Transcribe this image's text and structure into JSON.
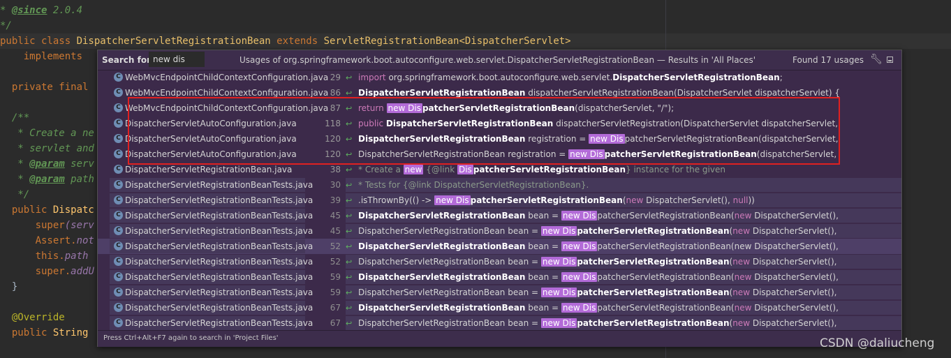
{
  "editor": {
    "lines": [
      {
        "a": "* ",
        "b": "@since",
        "c": " 2.0.4"
      },
      {
        "t": "*/"
      },
      {
        "kw": "public class ",
        "cls": "DispatcherServletRegistrationBean",
        "kw2": " extends ",
        "cls2": "ServletRegistrationBean<DispatcherServlet>"
      },
      {
        "kw": "    implements"
      },
      {
        "t": ""
      },
      {
        "kw": "  private final"
      },
      {
        "t": ""
      },
      {
        "t": "  /**"
      },
      {
        "t": "   * Create a ne"
      },
      {
        "t": "   * servlet and"
      },
      {
        "a": "   * ",
        "b": "@param",
        "c": " serv"
      },
      {
        "a": "   * ",
        "b": "@param",
        "c": " path"
      },
      {
        "t": "   */"
      },
      {
        "kw": "  public ",
        "d": "Dispatc"
      },
      {
        "kw": "      super",
        "e": "(serv"
      },
      {
        "kw": "      Assert.",
        "e": "not"
      },
      {
        "kw": "      this.",
        "e": "path"
      },
      {
        "kw": "      super.",
        "e": "addU"
      },
      {
        "t": "  }"
      },
      {
        "t": ""
      },
      {
        "ann": "  @Override"
      },
      {
        "kw": "  public ",
        "d": "String"
      }
    ]
  },
  "popup": {
    "search_label": "Search for:",
    "search_value": "new dis",
    "title": "Usages of org.springframework.boot.autoconfigure.web.servlet.DispatcherServletRegistrationBean — Results in 'All Places'",
    "found": "Found 17 usages",
    "settings_icon": "wrench-icon",
    "pin_icon": "pin-icon",
    "footer_hint": "Press Ctrl+Alt+F7 again to search in 'Project Files'",
    "rows": [
      {
        "file": "WebMvcEndpointChildContextConfiguration.java",
        "line": "29",
        "test": false,
        "sel": false,
        "parts": [
          {
            "k": "kw",
            "t": "import "
          },
          {
            "k": "n",
            "t": "org.springframework.boot.autoconfigure.web.servlet."
          },
          {
            "k": "b",
            "t": "DispatcherServletRegistrationBean"
          },
          {
            "k": "n",
            "t": ";"
          }
        ]
      },
      {
        "file": "WebMvcEndpointChildContextConfiguration.java",
        "line": "86",
        "test": false,
        "sel": false,
        "parts": [
          {
            "k": "b",
            "t": "DispatcherServletRegistrationBean"
          },
          {
            "k": "n",
            "t": " dispatcherServletRegistrationBean(DispatcherServlet dispatcherServlet) {"
          }
        ]
      },
      {
        "file": "WebMvcEndpointChildContextConfiguration.java",
        "line": "87",
        "test": false,
        "sel": false,
        "parts": [
          {
            "k": "kw",
            "t": "return "
          },
          {
            "k": "m",
            "t": "new Dis"
          },
          {
            "k": "b",
            "t": "patcherServletRegistrationBean"
          },
          {
            "k": "n",
            "t": "(dispatcherServlet, \"/\");"
          }
        ]
      },
      {
        "file": "DispatcherServletAutoConfiguration.java",
        "line": "118",
        "test": false,
        "sel": false,
        "parts": [
          {
            "k": "kw",
            "t": "public "
          },
          {
            "k": "b",
            "t": "DispatcherServletRegistrationBean"
          },
          {
            "k": "n",
            "t": " dispatcherServletRegistration(DispatcherServlet dispatcherServlet,"
          }
        ]
      },
      {
        "file": "DispatcherServletAutoConfiguration.java",
        "line": "120",
        "test": false,
        "sel": false,
        "parts": [
          {
            "k": "b",
            "t": "DispatcherServletRegistrationBean"
          },
          {
            "k": "n",
            "t": " registration = "
          },
          {
            "k": "m",
            "t": "new Dis"
          },
          {
            "k": "n",
            "t": "patcherServletRegistrationBean(dispatcherServlet,"
          }
        ]
      },
      {
        "file": "DispatcherServletAutoConfiguration.java",
        "line": "120",
        "test": false,
        "sel": false,
        "parts": [
          {
            "k": "n",
            "t": "DispatcherServletRegistrationBean registration = "
          },
          {
            "k": "m",
            "t": "new Dis"
          },
          {
            "k": "b",
            "t": "patcherServletRegistrationBean"
          },
          {
            "k": "n",
            "t": "(dispatcherServlet,"
          }
        ]
      },
      {
        "file": "DispatcherServletRegistrationBean.java",
        "line": "38",
        "test": false,
        "sel": false,
        "parts": [
          {
            "k": "cm",
            "t": "* Create a "
          },
          {
            "k": "m",
            "t": "new"
          },
          {
            "k": "cm",
            "t": " {@link "
          },
          {
            "k": "m",
            "t": "Dis"
          },
          {
            "k": "b",
            "t": "patcherServletRegistrationBean"
          },
          {
            "k": "cm",
            "t": "} instance for the given"
          }
        ]
      },
      {
        "file": "DispatcherServletRegistrationBeanTests.java",
        "line": "30",
        "test": true,
        "sel": false,
        "parts": [
          {
            "k": "cm",
            "t": "* Tests for {@link DispatcherServletRegistrationBean}."
          }
        ]
      },
      {
        "file": "DispatcherServletRegistrationBeanTests.java",
        "line": "39",
        "test": true,
        "sel": false,
        "parts": [
          {
            "k": "n",
            "t": ".isThrownBy(() -> "
          },
          {
            "k": "m",
            "t": "new Dis"
          },
          {
            "k": "b",
            "t": "patcherServletRegistrationBean"
          },
          {
            "k": "n",
            "t": "("
          },
          {
            "k": "kw",
            "t": "new "
          },
          {
            "k": "n",
            "t": "DispatcherServlet(), "
          },
          {
            "k": "kw",
            "t": "null"
          },
          {
            "k": "n",
            "t": "))"
          }
        ]
      },
      {
        "file": "DispatcherServletRegistrationBeanTests.java",
        "line": "45",
        "test": true,
        "sel": false,
        "parts": [
          {
            "k": "b",
            "t": "DispatcherServletRegistrationBean"
          },
          {
            "k": "n",
            "t": " bean = "
          },
          {
            "k": "m",
            "t": "new Dis"
          },
          {
            "k": "n",
            "t": "patcherServletRegistrationBean("
          },
          {
            "k": "kw",
            "t": "new "
          },
          {
            "k": "n",
            "t": "DispatcherServlet(),"
          }
        ]
      },
      {
        "file": "DispatcherServletRegistrationBeanTests.java",
        "line": "45",
        "test": true,
        "sel": false,
        "parts": [
          {
            "k": "n",
            "t": "DispatcherServletRegistrationBean bean = "
          },
          {
            "k": "m",
            "t": "new Dis"
          },
          {
            "k": "b",
            "t": "patcherServletRegistrationBean"
          },
          {
            "k": "n",
            "t": "("
          },
          {
            "k": "kw",
            "t": "new "
          },
          {
            "k": "n",
            "t": "DispatcherServlet(),"
          }
        ]
      },
      {
        "file": "DispatcherServletRegistrationBeanTests.java",
        "line": "52",
        "test": true,
        "sel": true,
        "parts": [
          {
            "k": "b",
            "t": "DispatcherServletRegistrationBean"
          },
          {
            "k": "n",
            "t": " bean = "
          },
          {
            "k": "m",
            "t": "new Dis"
          },
          {
            "k": "n",
            "t": "patcherServletRegistrationBean(new DispatcherServlet(),"
          }
        ]
      },
      {
        "file": "DispatcherServletRegistrationBeanTests.java",
        "line": "52",
        "test": true,
        "sel": false,
        "parts": [
          {
            "k": "n",
            "t": "DispatcherServletRegistrationBean bean = "
          },
          {
            "k": "m",
            "t": "new Dis"
          },
          {
            "k": "b",
            "t": "patcherServletRegistrationBean"
          },
          {
            "k": "n",
            "t": "("
          },
          {
            "k": "kw",
            "t": "new "
          },
          {
            "k": "n",
            "t": "DispatcherServlet(),"
          }
        ]
      },
      {
        "file": "DispatcherServletRegistrationBeanTests.java",
        "line": "59",
        "test": true,
        "sel": false,
        "parts": [
          {
            "k": "b",
            "t": "DispatcherServletRegistrationBean"
          },
          {
            "k": "n",
            "t": " bean = "
          },
          {
            "k": "m",
            "t": "new Dis"
          },
          {
            "k": "n",
            "t": "patcherServletRegistrationBean("
          },
          {
            "k": "kw",
            "t": "new "
          },
          {
            "k": "n",
            "t": "DispatcherServlet(),"
          }
        ]
      },
      {
        "file": "DispatcherServletRegistrationBeanTests.java",
        "line": "59",
        "test": true,
        "sel": false,
        "parts": [
          {
            "k": "n",
            "t": "DispatcherServletRegistrationBean bean = "
          },
          {
            "k": "m",
            "t": "new Dis"
          },
          {
            "k": "b",
            "t": "patcherServletRegistrationBean"
          },
          {
            "k": "n",
            "t": "("
          },
          {
            "k": "kw",
            "t": "new "
          },
          {
            "k": "n",
            "t": "DispatcherServlet(),"
          }
        ]
      },
      {
        "file": "DispatcherServletRegistrationBeanTests.java",
        "line": "67",
        "test": true,
        "sel": false,
        "parts": [
          {
            "k": "b",
            "t": "DispatcherServletRegistrationBean"
          },
          {
            "k": "n",
            "t": " bean = "
          },
          {
            "k": "m",
            "t": "new Dis"
          },
          {
            "k": "n",
            "t": "patcherServletRegistrationBean("
          },
          {
            "k": "kw",
            "t": "new "
          },
          {
            "k": "n",
            "t": "DispatcherServlet(),"
          }
        ]
      },
      {
        "file": "DispatcherServletRegistrationBeanTests.java",
        "line": "67",
        "test": true,
        "sel": false,
        "parts": [
          {
            "k": "n",
            "t": "DispatcherServletRegistrationBean bean = "
          },
          {
            "k": "m",
            "t": "new Dis"
          },
          {
            "k": "b",
            "t": "patcherServletRegistrationBean"
          },
          {
            "k": "n",
            "t": "("
          },
          {
            "k": "kw",
            "t": "new "
          },
          {
            "k": "n",
            "t": "DispatcherServlet(),"
          }
        ]
      }
    ]
  },
  "watermark": "CSDN @daliucheng"
}
